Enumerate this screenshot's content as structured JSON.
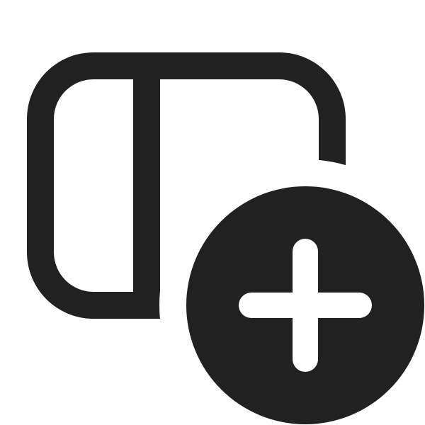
{
  "icon": {
    "name": "panel-left-add-icon",
    "color": "#212121",
    "background": "#ffffff",
    "parts": [
      "panel-outline-icon",
      "panel-divider-icon",
      "add-badge-icon",
      "plus-icon"
    ]
  }
}
